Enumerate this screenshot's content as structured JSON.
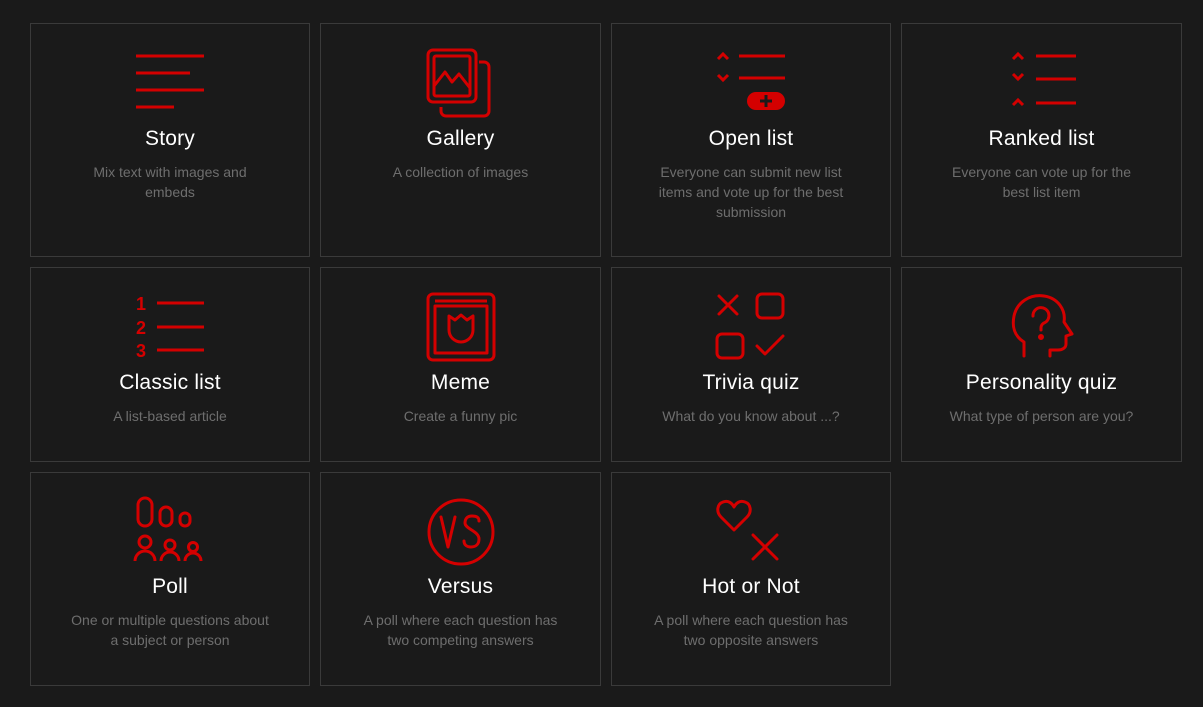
{
  "accent_color": "#d40000",
  "cards": [
    {
      "title": "Story",
      "desc": "Mix text with images and embeds",
      "icon": "story-icon"
    },
    {
      "title": "Gallery",
      "desc": "A collection of images",
      "icon": "gallery-icon"
    },
    {
      "title": "Open list",
      "desc": "Everyone can submit new list items and vote up for the best submission",
      "icon": "open-list-icon"
    },
    {
      "title": "Ranked list",
      "desc": "Everyone can vote up for the best list item",
      "icon": "ranked-list-icon"
    },
    {
      "title": "Classic list",
      "desc": "A list-based article",
      "icon": "classic-list-icon"
    },
    {
      "title": "Meme",
      "desc": "Create a funny pic",
      "icon": "meme-icon"
    },
    {
      "title": "Trivia quiz",
      "desc": "What do you know about ...?",
      "icon": "trivia-quiz-icon"
    },
    {
      "title": "Personality quiz",
      "desc": "What type of person are you?",
      "icon": "personality-quiz-icon"
    },
    {
      "title": "Poll",
      "desc": "One or multiple questions about a subject or person",
      "icon": "poll-icon"
    },
    {
      "title": "Versus",
      "desc": "A poll where each question has two competing answers",
      "icon": "versus-icon"
    },
    {
      "title": "Hot or Not",
      "desc": "A poll where each question has two opposite answers",
      "icon": "hot-or-not-icon"
    }
  ]
}
